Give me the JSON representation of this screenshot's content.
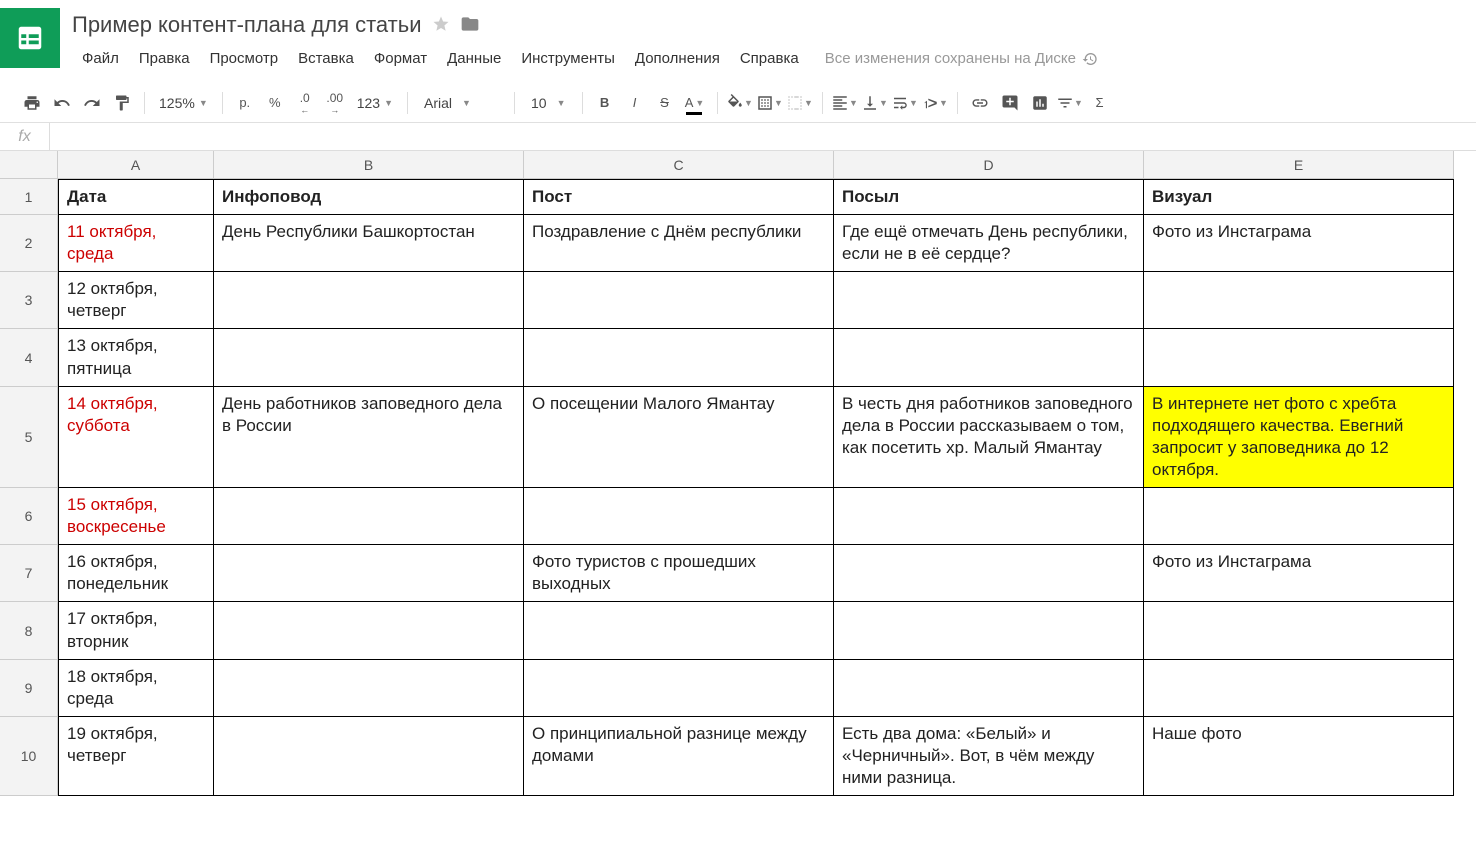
{
  "title": "Пример контент-плана для статьи",
  "menu": [
    "Файл",
    "Правка",
    "Просмотр",
    "Вставка",
    "Формат",
    "Данные",
    "Инструменты",
    "Дополнения",
    "Справка"
  ],
  "save_status": "Все изменения сохранены на Диске",
  "toolbar": {
    "zoom": "125%",
    "currency": "р.",
    "percent": "%",
    "dec_dec": ".0",
    "dec_inc": ".00",
    "format": "123",
    "font": "Arial",
    "font_size": "10"
  },
  "fx": "fx",
  "columns": [
    "A",
    "B",
    "C",
    "D",
    "E"
  ],
  "headers": [
    "Дата",
    "Инфоповод",
    "Пост",
    "Посыл",
    "Визуал"
  ],
  "rows": [
    {
      "num": "1",
      "cells": [
        "Дата",
        "Инфоповод",
        "Пост",
        "Посыл",
        "Визуал"
      ],
      "bold": true
    },
    {
      "num": "2",
      "cells": [
        "11 октября, среда",
        "День Республики Башкортостан",
        "Поздравление с Днём республики",
        "Где ещё отмечать День республики, если не в её сердце?",
        "Фото из Инстаграма"
      ],
      "red": true
    },
    {
      "num": "3",
      "cells": [
        "12 октября, четверг",
        "",
        "",
        "",
        ""
      ]
    },
    {
      "num": "4",
      "cells": [
        "13 октября, пятница",
        "",
        "",
        "",
        ""
      ]
    },
    {
      "num": "5",
      "cells": [
        "14 октября, суббота",
        "День работников заповедного дела в России",
        "О посещении Малого Ямантау",
        "В честь дня работников заповедного дела в России рассказываем о том, как посетить хр. Малый Ямантау",
        "В интернете нет фото с хребта подходящего качества. Евегний запросит у заповедника до 12 октября."
      ],
      "red": true,
      "yellow_col": 4
    },
    {
      "num": "6",
      "cells": [
        "15 октября, воскресенье",
        "",
        "",
        "",
        ""
      ],
      "red": true
    },
    {
      "num": "7",
      "cells": [
        "16 октября, понедельник",
        "",
        "Фото туристов с прошедших выходных",
        "",
        "Фото из Инстаграма"
      ]
    },
    {
      "num": "8",
      "cells": [
        "17 октября, вторник",
        "",
        "",
        "",
        ""
      ]
    },
    {
      "num": "9",
      "cells": [
        "18 октября, среда",
        "",
        "",
        "",
        ""
      ]
    },
    {
      "num": "10",
      "cells": [
        "19 октября, четверг",
        "",
        "О принципиальной разнице между домами",
        "Есть два дома: «Белый» и «Черничный». Вот, в чём между ними разница.",
        "Наше фото"
      ]
    }
  ]
}
